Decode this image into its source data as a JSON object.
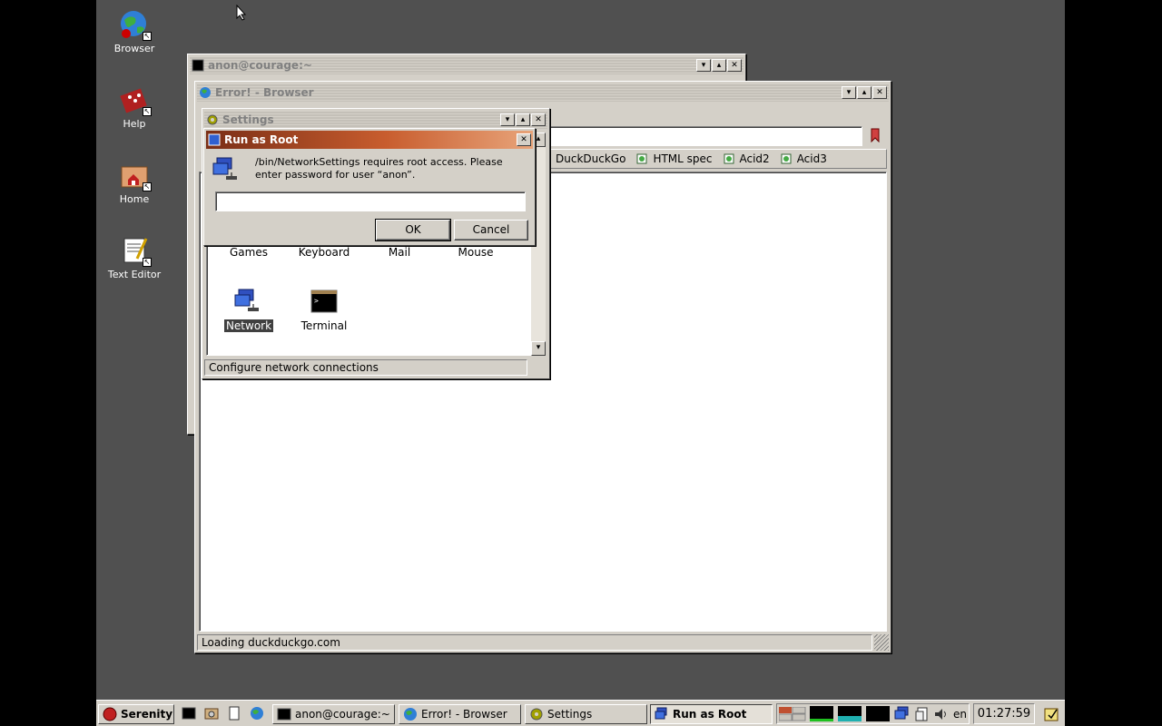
{
  "desktop": {
    "icons": [
      {
        "label": "Browser",
        "icon": "globe-icon"
      },
      {
        "label": "Help",
        "icon": "help-book-icon"
      },
      {
        "label": "Home",
        "icon": "home-folder-icon"
      },
      {
        "label": "Text Editor",
        "icon": "text-editor-icon"
      }
    ]
  },
  "terminal_window": {
    "title": "anon@courage:~"
  },
  "browser_window": {
    "title": "Error! - Browser",
    "bookmarks": [
      "DuckDuckGo",
      "HTML spec",
      "Acid2",
      "Acid3"
    ],
    "status": "Loading duckduckgo.com"
  },
  "settings_window": {
    "title": "Settings",
    "items": [
      {
        "label": "Games"
      },
      {
        "label": "Keyboard"
      },
      {
        "label": "Mail"
      },
      {
        "label": "Mouse"
      },
      {
        "label": "Network",
        "selected": true
      },
      {
        "label": "Terminal"
      }
    ],
    "status": "Configure network connections"
  },
  "dialog": {
    "title": "Run as Root",
    "message_line1": "/bin/NetworkSettings requires root access. Please",
    "message_line2": "enter password for user “anon”.",
    "password_value": "",
    "ok_label": "OK",
    "cancel_label": "Cancel"
  },
  "taskbar": {
    "start_label": "Serenity",
    "tasks": [
      {
        "label": "anon@courage:~"
      },
      {
        "label": "Error! - Browser"
      },
      {
        "label": "Settings"
      },
      {
        "label": "Run as Root",
        "active": true
      }
    ],
    "keymap": "en",
    "clock": "01:27:59"
  },
  "colors": {
    "desktop": "#505050",
    "active_title_start": "#7a2e16",
    "active_title_end": "#e8a47a",
    "chrome": "#d4d0c8"
  }
}
